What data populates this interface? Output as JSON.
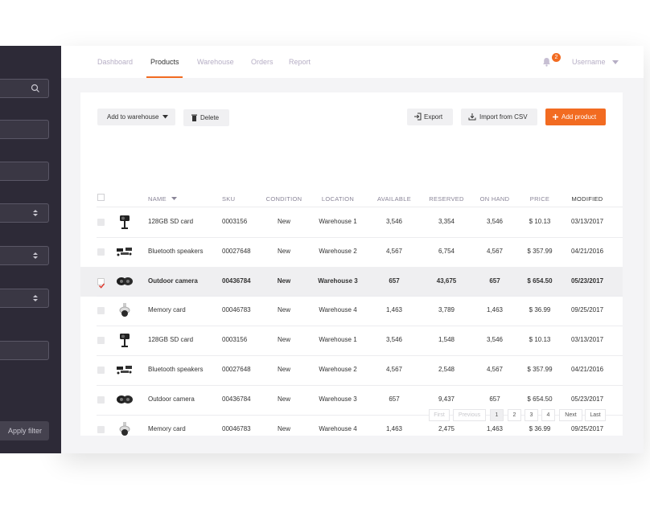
{
  "nav": {
    "tabs": [
      "Dashboard",
      "Products",
      "Warehouse",
      "Orders",
      "Report"
    ],
    "active": "Products",
    "notifications": "2",
    "username": "Username"
  },
  "sidebar": {
    "apply_filter": "Apply filter",
    "fields": [
      {
        "type": "search"
      },
      {
        "type": "text"
      },
      {
        "type": "text"
      },
      {
        "type": "select"
      },
      {
        "type": "select"
      },
      {
        "type": "select"
      },
      {
        "type": "text"
      }
    ]
  },
  "toolbar": {
    "add_to_warehouse": "Add to warehouse",
    "delete": "Delete",
    "export": "Export",
    "import_csv": "Import from CSV",
    "add_product": "Add product"
  },
  "table": {
    "headers": {
      "name": "NAME",
      "sku": "SKU",
      "condition": "CONDITION",
      "location": "LOCATION",
      "available": "AVAILABLE",
      "reserved": "RESERVED",
      "on_hand": "ON HAND",
      "price": "PRICE",
      "modified": "MODIFIED"
    },
    "rows": [
      {
        "name": "128GB SD card",
        "sku": "0003156",
        "condition": "New",
        "location": "Warehouse 1",
        "available": "3,546",
        "reserved": "3,354",
        "on_hand": "3,546",
        "price": "$ 10.13",
        "modified": "03/13/2017",
        "icon": "dashcam-icon",
        "checked": false
      },
      {
        "name": "Bluetooth speakers",
        "sku": "00027648",
        "condition": "New",
        "location": "Warehouse 2",
        "available": "4,567",
        "reserved": "6,754",
        "on_hand": "4,567",
        "price": "$ 357.99",
        "modified": "04/21/2016",
        "icon": "security-camera-kit-icon",
        "checked": false
      },
      {
        "name": "Outdoor camera",
        "sku": "00436784",
        "condition": "New",
        "location": "Warehouse 3",
        "available": "657",
        "reserved": "43,675",
        "on_hand": "657",
        "price": "$ 654.50",
        "modified": "05/23/2017",
        "icon": "outdoor-camera-icon",
        "checked": true
      },
      {
        "name": "Memory card",
        "sku": "00046783",
        "condition": "New",
        "location": "Warehouse 4",
        "available": "1,463",
        "reserved": "3,789",
        "on_hand": "1,463",
        "price": "$ 36.99",
        "modified": "09/25/2017",
        "icon": "dome-camera-icon",
        "checked": false
      },
      {
        "name": "128GB SD card",
        "sku": "0003156",
        "condition": "New",
        "location": "Warehouse 1",
        "available": "3,546",
        "reserved": "1,548",
        "on_hand": "3,546",
        "price": "$ 10.13",
        "modified": "03/13/2017",
        "icon": "dashcam-icon",
        "checked": false
      },
      {
        "name": "Bluetooth speakers",
        "sku": "00027648",
        "condition": "New",
        "location": "Warehouse 2",
        "available": "4,567",
        "reserved": "2,548",
        "on_hand": "4,567",
        "price": "$ 357.99",
        "modified": "04/21/2016",
        "icon": "security-camera-kit-icon",
        "checked": false
      },
      {
        "name": "Outdoor camera",
        "sku": "00436784",
        "condition": "New",
        "location": "Warehouse 3",
        "available": "657",
        "reserved": "9,437",
        "on_hand": "657",
        "price": "$ 654.50",
        "modified": "05/23/2017",
        "icon": "outdoor-camera-icon",
        "checked": false
      },
      {
        "name": "Memory card",
        "sku": "00046783",
        "condition": "New",
        "location": "Warehouse 4",
        "available": "1,463",
        "reserved": "2,475",
        "on_hand": "1,463",
        "price": "$ 36.99",
        "modified": "09/25/2017",
        "icon": "dome-camera-icon",
        "checked": false
      }
    ]
  },
  "pagination": {
    "first": "First",
    "previous": "Previous",
    "pages": [
      "1",
      "2",
      "3",
      "4"
    ],
    "current": "1",
    "next": "Next",
    "last": "Last"
  },
  "colors": {
    "accent": "#f26b21",
    "sidebar": "#2d2a37"
  }
}
